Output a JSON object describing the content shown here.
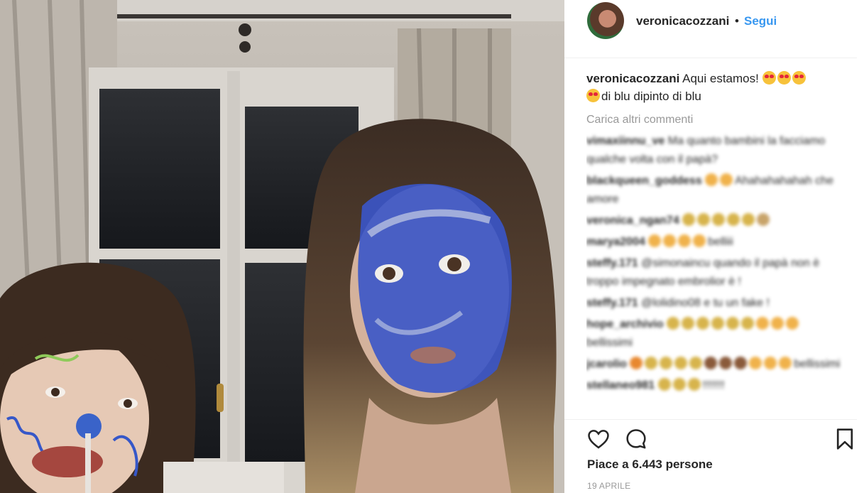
{
  "post": {
    "username": "veronicacozzani",
    "separator": "•",
    "follow_label": "Segui",
    "caption_user": "veronicacozzani",
    "caption_text_1": "Aqui estamos!",
    "caption_text_2": "di blu dipinto di blu",
    "load_more_label": "Carica altri commenti",
    "likes_label": "Piace a 6.443 persone",
    "date_label": "19 APRILE"
  },
  "blurred_comments": [
    {
      "user": "vimaxiinnu_ve",
      "text": "Ma quanto bambini la facciamo qualche volta con il papà?"
    },
    {
      "user": "blackqueen_goddess",
      "text": "Ahahahahahah che amore",
      "emoji": [
        "#f0b24b",
        "#f0b24b"
      ]
    },
    {
      "user": "veronica_ngan74",
      "text": "",
      "emoji": [
        "#d7b44c",
        "#d7b44c",
        "#d7b44c",
        "#d7b44c",
        "#d7b44c",
        "#c8a46a"
      ]
    },
    {
      "user": "marya2004",
      "text": "belliii",
      "emoji": [
        "#f0b24b",
        "#f0b24b",
        "#f0b24b",
        "#f0b24b"
      ]
    },
    {
      "user": "steffy.171",
      "text": "@simonaincu quando il papà non è troppo impegnato embrolior è !"
    },
    {
      "user": "steffy.171",
      "text": "@lolidino08 e tu un fake !"
    },
    {
      "user": "hope_archivio",
      "text": "bellissimi",
      "emoji": [
        "#d7b44c",
        "#d7b44c",
        "#d7b44c",
        "#d7b44c",
        "#d7b44c",
        "#d7b44c",
        "#f0b24b",
        "#f0b24b",
        "#f0b24b"
      ]
    },
    {
      "user": "jcarolio",
      "text": "bellissimi",
      "emoji": [
        "#e8882f",
        "#d7b44c",
        "#d7b44c",
        "#d7b44c",
        "#d7b44c",
        "#8a5a3a",
        "#8a5a3a",
        "#8a5a3a",
        "#f0b24b",
        "#f0b24b",
        "#f0b24b"
      ]
    },
    {
      "user": "stellaneo981",
      "text": "!!!!!!!",
      "emoji": [
        "#d7b44c",
        "#d7b44c",
        "#d7b44c"
      ]
    }
  ],
  "icons": {
    "like": "heart-icon",
    "comment": "comment-bubble-icon",
    "save": "bookmark-icon"
  },
  "colors": {
    "follow": "#3897f0",
    "muted": "#999999"
  }
}
